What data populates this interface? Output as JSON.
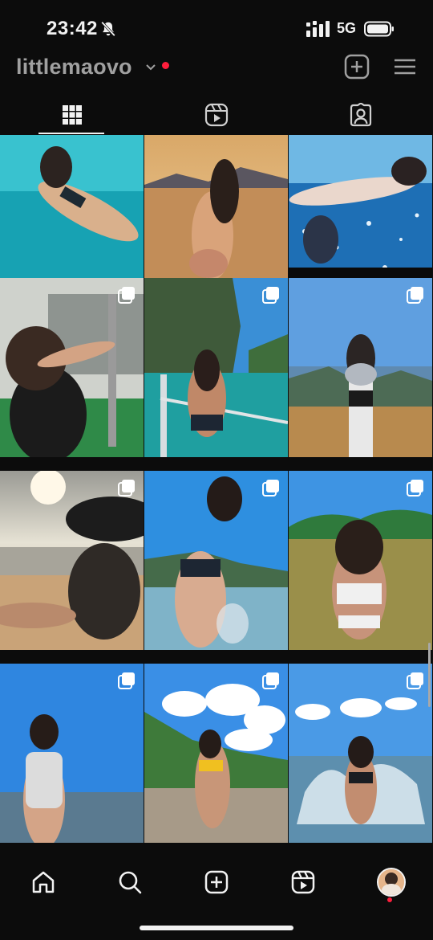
{
  "status_bar": {
    "time": "23:42",
    "network": "5G",
    "icons": [
      "bell-muted-icon",
      "signal-icon",
      "battery-icon"
    ]
  },
  "header": {
    "username": "littlemaovo",
    "icons": [
      "chevron-down-icon",
      "notification-dot",
      "create-plus-icon",
      "menu-icon"
    ]
  },
  "profile_tabs": {
    "items": [
      "grid-icon",
      "reels-icon",
      "tagged-icon"
    ],
    "active": 0
  },
  "grid": {
    "posts": [
      {
        "scene": "underwater swimmer in turquoise water",
        "multi": false
      },
      {
        "scene": "woman at sunset beach with islands",
        "multi": false
      },
      {
        "scene": "underwater swimmer among bubbles",
        "multi": false
      },
      {
        "scene": "woman with rifle at shooting range",
        "multi": true
      },
      {
        "scene": "woman in bikini on boat near cliffs",
        "multi": true
      },
      {
        "scene": "woman on post above bay view",
        "multi": true
      },
      {
        "scene": "woman in hat on sunny beach",
        "multi": true
      },
      {
        "scene": "woman posing in shallow water",
        "multi": true
      },
      {
        "scene": "woman in white swimsuit in sea",
        "multi": true
      },
      {
        "scene": "woman in white one-piece at beach",
        "multi": true
      },
      {
        "scene": "woman on rocky shore with clouds",
        "multi": true
      },
      {
        "scene": "woman splashing water in sea",
        "multi": true
      }
    ]
  },
  "bottom_nav": {
    "items": [
      "home-icon",
      "search-icon",
      "create-icon",
      "reels-icon",
      "profile-avatar"
    ]
  },
  "colors": {
    "background": "#0c0c0c",
    "text": "#f2f2f2",
    "username": "#a0a0a0",
    "notification": "#ff1e3c"
  }
}
